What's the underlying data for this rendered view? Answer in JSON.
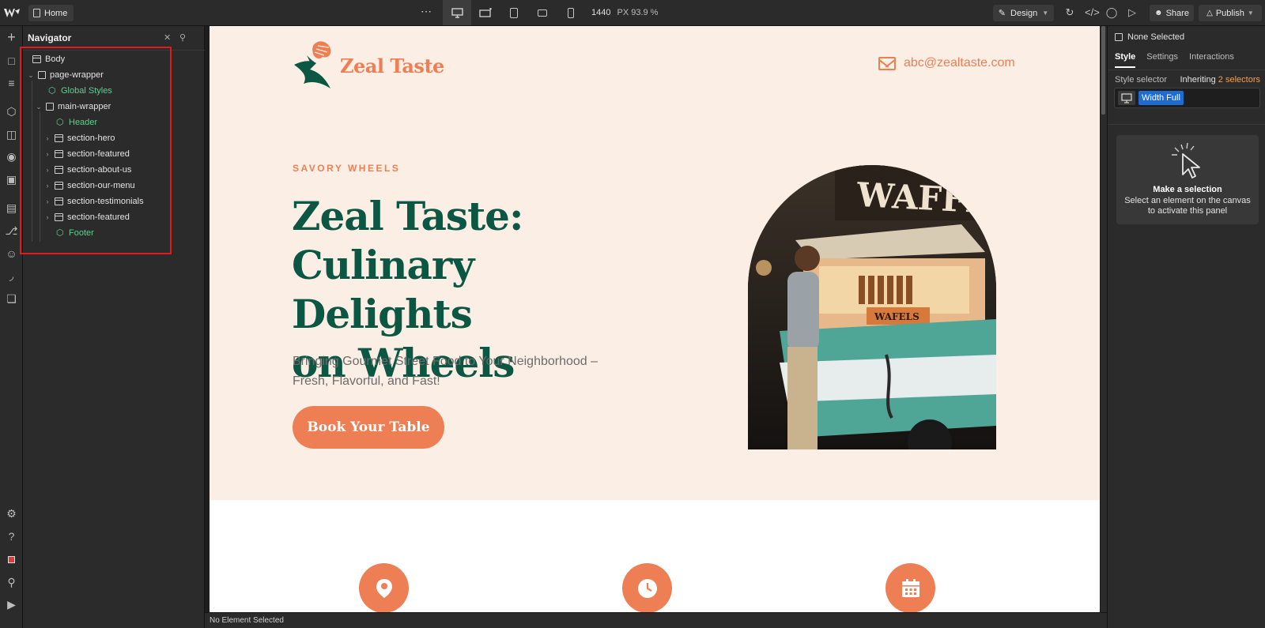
{
  "topbar": {
    "page_label": "Home",
    "more": "⋯",
    "canvas_width": "1440",
    "canvas_unit_zoom": "PX 93.9 %",
    "mode_label": "Design",
    "share_label": "Share",
    "publish_label": "Publish"
  },
  "navigator": {
    "title": "Navigator",
    "tree": [
      {
        "label": "Body"
      },
      {
        "label": "page-wrapper"
      },
      {
        "label": "Global Styles"
      },
      {
        "label": "main-wrapper"
      },
      {
        "label": "Header"
      },
      {
        "label": "section-hero"
      },
      {
        "label": "section-featured"
      },
      {
        "label": "section-about-us"
      },
      {
        "label": "section-our-menu"
      },
      {
        "label": "section-testimonials"
      },
      {
        "label": "section-featured"
      },
      {
        "label": "Footer"
      }
    ]
  },
  "site": {
    "brand": "Zeal Taste",
    "email": "abc@zealtaste.com",
    "eyebrow": "SAVORY WHEELS",
    "headline_1": "Zeal Taste:",
    "headline_2": "Culinary Delights",
    "headline_3": "on Wheels",
    "subtitle": "Bringing Gourmet Street Food to Your Neighborhood – Fresh, Flavorful, and Fast!",
    "cta": "Book Your Table",
    "photo_sign": "WAFFLES",
    "photo_counter": "WAFELS",
    "accent": "#ee7f54",
    "heading_color": "#0c5743",
    "hero_bg": "#fbeee5"
  },
  "status_bar": {
    "text": "No Element Selected"
  },
  "right_panel": {
    "none_selected": "None Selected",
    "tabs": [
      "Style",
      "Settings",
      "Interactions"
    ],
    "style_selector_label": "Style selector",
    "inheriting_prefix": "Inheriting",
    "inheriting_count": "2 selectors",
    "selector_tag": "Width Full",
    "card_title": "Make a selection",
    "card_desc": "Select an element on the canvas to activate this panel"
  }
}
